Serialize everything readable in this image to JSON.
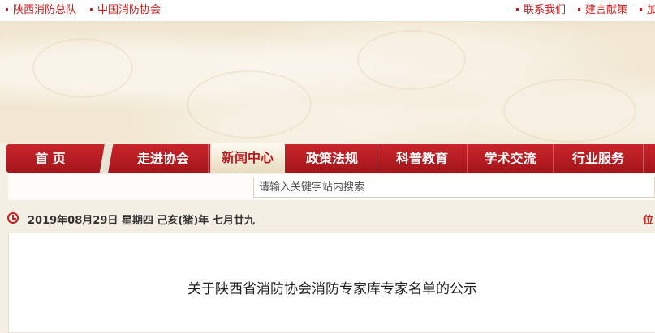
{
  "topbar": {
    "left_links": [
      "陕西消防总队",
      "中国消防协会"
    ],
    "right_links": [
      "联系我们",
      "建言献策",
      "加"
    ]
  },
  "nav": {
    "items": [
      "首 页",
      "走进协会",
      "新闻中心",
      "政策法规",
      "科普教育",
      "学术交流",
      "行业服务"
    ],
    "active": "新闻中心"
  },
  "search": {
    "placeholder": "请输入关键字站内搜索"
  },
  "date": {
    "text": "2019年08月29日 星期四  己亥(猪)年 七月廿九",
    "position_label": "位"
  },
  "article": {
    "title": "关于陕西省消防协会消防专家库专家名单的公示"
  },
  "colors": {
    "brand_red": "#c81d1d",
    "nav_red": "#b51a1f",
    "banner_bg": "#f1e6cf"
  }
}
